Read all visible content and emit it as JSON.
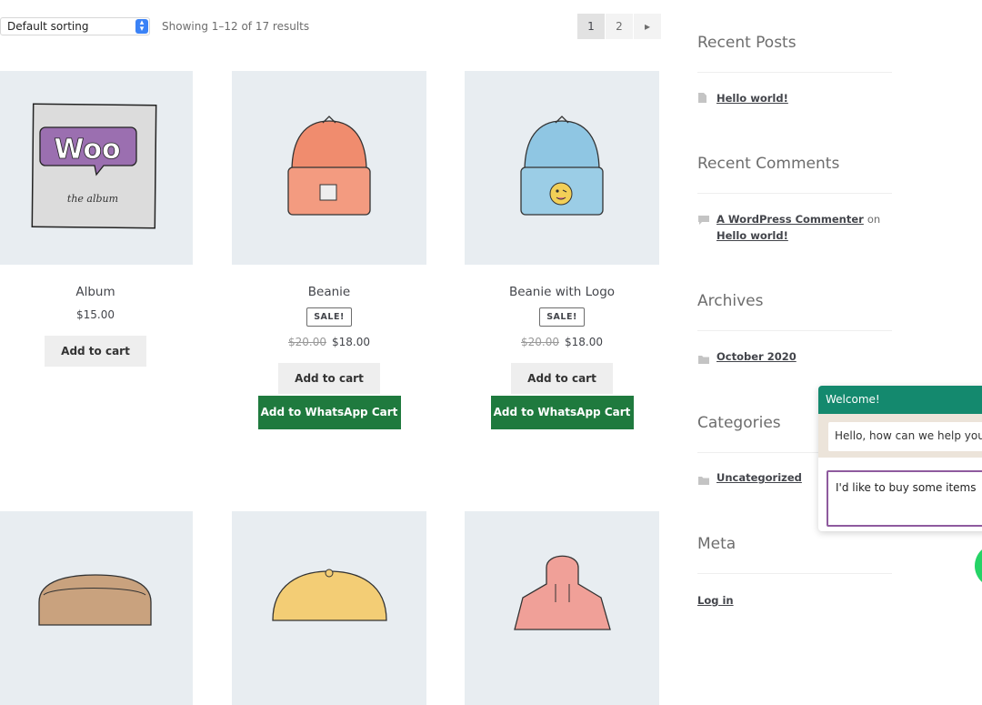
{
  "toolbar": {
    "sort_value": "Default sorting",
    "result_count": "Showing 1–12 of 17 results",
    "pages": [
      "1",
      "2"
    ]
  },
  "products": [
    {
      "title": "Album",
      "price": "$15.00",
      "add_to_cart": "Add to cart"
    },
    {
      "title": "Beanie",
      "sale_badge": "SALE!",
      "old_price": "$20.00",
      "price": "$18.00",
      "add_to_cart": "Add to cart",
      "whatsapp": "Add to WhatsApp Cart"
    },
    {
      "title": "Beanie with Logo",
      "sale_badge": "SALE!",
      "old_price": "$20.00",
      "price": "$18.00",
      "add_to_cart": "Add to cart",
      "whatsapp": "Add to WhatsApp Cart"
    }
  ],
  "album_art": {
    "logo_text": "Woo",
    "subtitle": "the album"
  },
  "sidebar": {
    "recent_posts_title": "Recent Posts",
    "recent_post": "Hello world!",
    "recent_comments_title": "Recent Comments",
    "comment_author": "A WordPress Commenter",
    "comment_on": "on",
    "comment_post": "Hello world!",
    "archives_title": "Archives",
    "archive_item": "October 2020",
    "categories_title": "Categories",
    "category_item": "Uncategorized",
    "meta_title": "Meta",
    "meta_item": "Log in"
  },
  "chat": {
    "header": "Welcome!",
    "greeting": "Hello, how can we help you?",
    "input_value": "I'd like to buy some items"
  },
  "colors": {
    "whatsapp_green": "#1f7a3e",
    "chat_header": "#14896e",
    "input_border": "#8e5a9e"
  }
}
